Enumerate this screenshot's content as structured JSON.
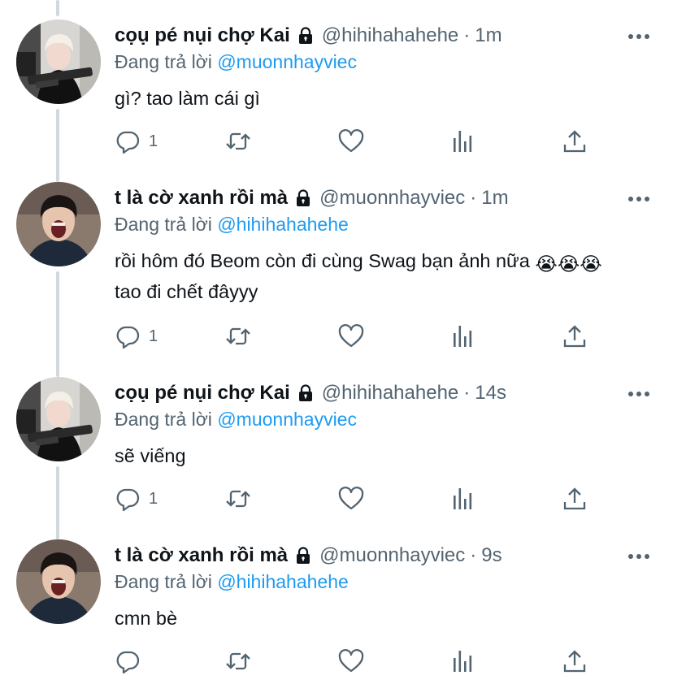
{
  "tweets": [
    {
      "name": "cọụ pé nụi chợ Kai",
      "handle": "@hihihahahehe",
      "separator": "·",
      "time": "1m",
      "replying_prefix": "Đang trả lời ",
      "replying_to": "@muonnhayviec",
      "text": "gì? tao làm cái gì",
      "emojis": "",
      "reply_count": "1",
      "avatar": "blonde-avatar"
    },
    {
      "name": "t là cờ xanh rồi mà",
      "handle": "@muonnhayviec",
      "separator": "·",
      "time": "1m",
      "replying_prefix": "Đang trả lời ",
      "replying_to": "@hihihahahehe",
      "text": "rồi hôm đó Beom còn đi cùng Swag bạn ảnh nữa ",
      "text_line2": "tao đi chết đâyyy",
      "emojis": "😭😭😭",
      "reply_count": "1",
      "avatar": "dark-hair-avatar"
    },
    {
      "name": "cọụ pé nụi chợ Kai",
      "handle": "@hihihahahehe",
      "separator": "·",
      "time": "14s",
      "replying_prefix": "Đang trả lời ",
      "replying_to": "@muonnhayviec",
      "text": "sẽ viếng",
      "emojis": "",
      "reply_count": "1",
      "avatar": "blonde-avatar"
    },
    {
      "name": "t là cờ xanh rồi mà",
      "handle": "@muonnhayviec",
      "separator": "·",
      "time": "9s",
      "replying_prefix": "Đang trả lời ",
      "replying_to": "@hihihahahehe",
      "text": "cmn bè",
      "emojis": "",
      "reply_count": "",
      "avatar": "dark-hair-avatar"
    }
  ],
  "colors": {
    "mention": "#1d9bf0",
    "secondary_text": "#536471",
    "primary_text": "#0f1419",
    "thread_line": "#cfd9de"
  },
  "icons": [
    "lock-icon",
    "more-icon",
    "reply-icon",
    "retweet-icon",
    "like-icon",
    "analytics-icon",
    "share-icon"
  ]
}
